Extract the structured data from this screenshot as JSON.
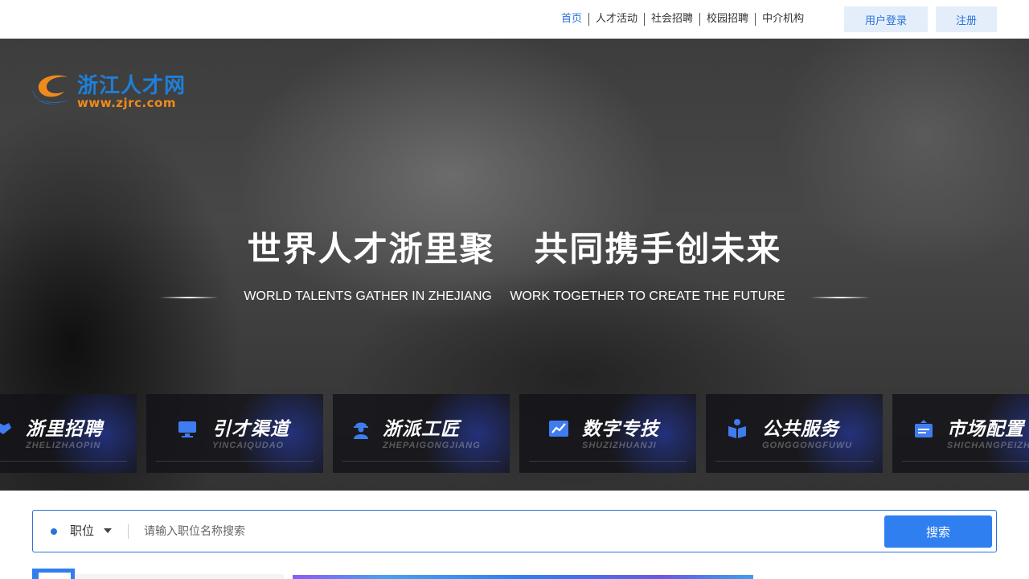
{
  "topnav": {
    "items": [
      "首页",
      "人才活动",
      "社会招聘",
      "校园招聘",
      "中介机构"
    ],
    "login": "用户登录",
    "register": "注册"
  },
  "logo": {
    "name_cn": "浙江人才网",
    "url": "www.zjrc.com"
  },
  "hero": {
    "title_part1": "世界人才浙里聚",
    "title_part2": "共同携手创未来",
    "subtitle_part1": "WORLD TALENTS GATHER IN ZHEJIANG",
    "subtitle_part2": "WORK TOGETHER TO CREATE THE FUTURE"
  },
  "cards": [
    {
      "title": "浙里招聘",
      "sub": "ZHELIZHAOPIN",
      "icon": "handshake-icon"
    },
    {
      "title": "引才渠道",
      "sub": "YINCAIQUDAO",
      "icon": "monitor-icon"
    },
    {
      "title": "浙派工匠",
      "sub": "ZHEPAIGONGJIANG",
      "icon": "worker-icon"
    },
    {
      "title": "数字专技",
      "sub": "SHUZIZHUANJI",
      "icon": "chart-icon"
    },
    {
      "title": "公共服务",
      "sub": "GONGGONGFUWU",
      "icon": "service-icon"
    },
    {
      "title": "市场配置",
      "sub": "SHICHANGPEIZHI",
      "icon": "briefcase-icon"
    }
  ],
  "search": {
    "type": "职位",
    "placeholder": "请输入职位名称搜索",
    "button": "搜索"
  },
  "colors": {
    "accent": "#2a73d8",
    "button": "#2f7ff0",
    "logo_blue": "#1f7fd9",
    "logo_orange": "#f08a1c"
  }
}
